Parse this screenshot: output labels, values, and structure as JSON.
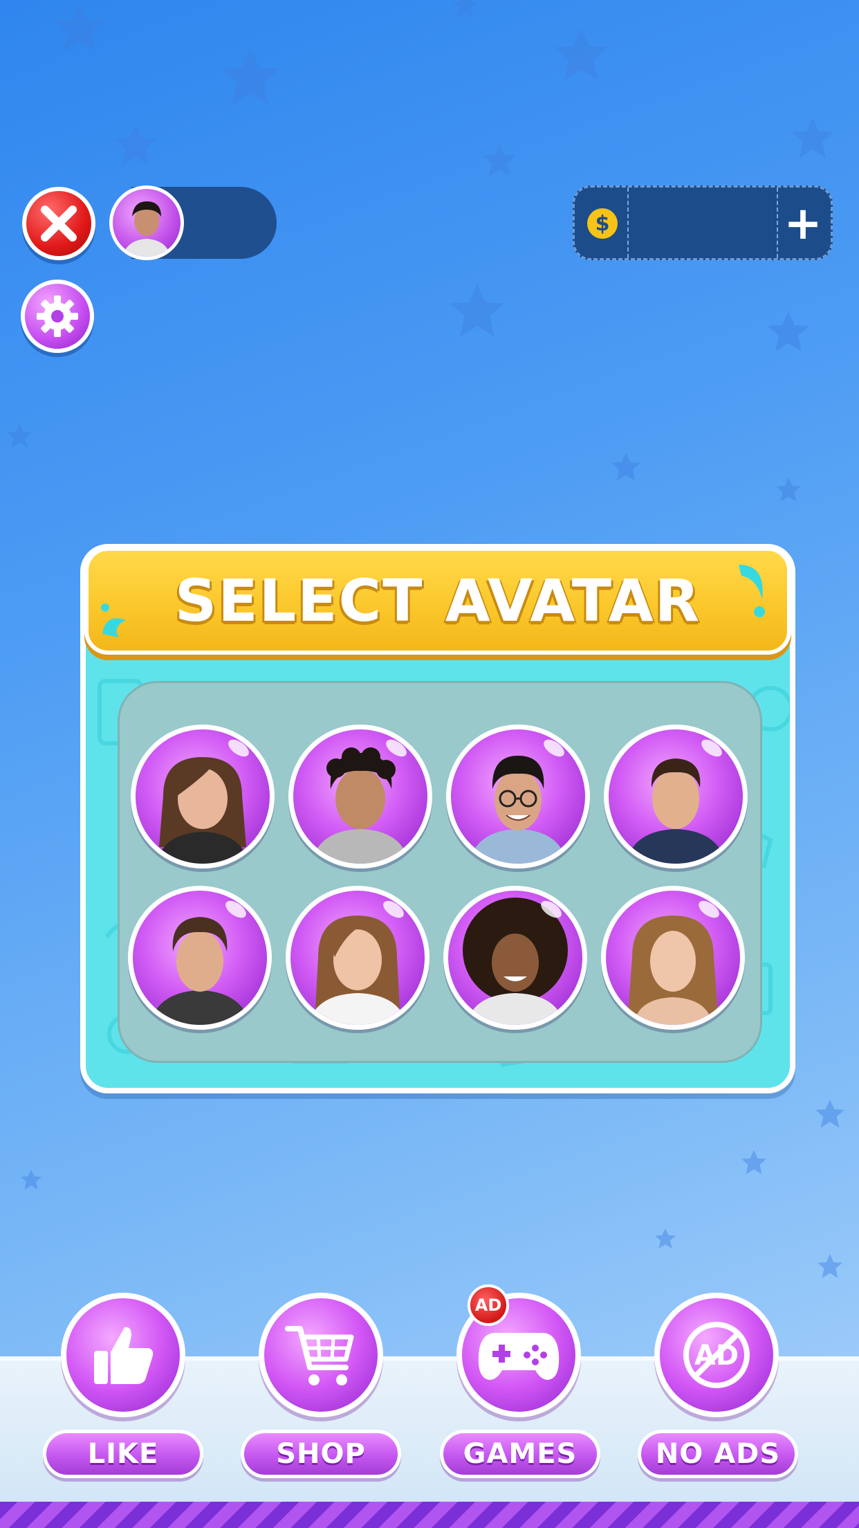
{
  "header": {
    "close_icon": "close-icon",
    "settings_icon": "gear-icon",
    "coin_symbol": "$",
    "plus_symbol": "+"
  },
  "panel": {
    "title": "SELECT AVATAR"
  },
  "avatars": [
    {
      "name": "avatar-1",
      "hair": "#5a3a25",
      "style": "long"
    },
    {
      "name": "avatar-2",
      "hair": "#1e1612",
      "style": "curly"
    },
    {
      "name": "avatar-3",
      "hair": "#1a1614",
      "style": "short-glasses"
    },
    {
      "name": "avatar-4",
      "hair": "#3a2418",
      "style": "short"
    },
    {
      "name": "avatar-5",
      "hair": "#4a3020",
      "style": "short"
    },
    {
      "name": "avatar-6",
      "hair": "#8a5a35",
      "style": "long"
    },
    {
      "name": "avatar-7",
      "hair": "#2a1a10",
      "style": "afro"
    },
    {
      "name": "avatar-8",
      "hair": "#9a6a3a",
      "style": "long"
    }
  ],
  "menu": {
    "like": "LIKE",
    "shop": "SHOP",
    "games": "GAMES",
    "no_ads": "NO ADS",
    "ad_badge": "AD",
    "no_ads_icon_text": "AD"
  },
  "colors": {
    "accent_purple": "#c44bf0",
    "banner_yellow": "#fbc82c",
    "panel_cyan": "#5fe3ea"
  }
}
